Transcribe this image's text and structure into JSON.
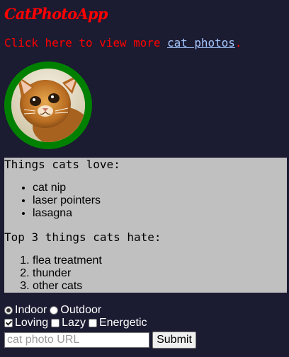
{
  "header": {
    "title": "CatPhotoApp"
  },
  "intro": {
    "prefix": "Click here to view more ",
    "link_text": "cat photos",
    "suffix": "."
  },
  "image": {
    "alt": "A cute orange cat lying on its back"
  },
  "lists": {
    "love_heading": "Things cats love:",
    "love_items": [
      "cat nip",
      "laser pointers",
      "lasagna"
    ],
    "hate_heading": "Top 3 things cats hate:",
    "hate_items": [
      "flea treatment",
      "thunder",
      "other cats"
    ]
  },
  "form": {
    "radios": [
      {
        "label": "Indoor",
        "checked": true
      },
      {
        "label": "Outdoor",
        "checked": false
      }
    ],
    "checkboxes": [
      {
        "label": "Loving",
        "checked": true
      },
      {
        "label": "Lazy",
        "checked": false
      },
      {
        "label": "Energetic",
        "checked": false
      }
    ],
    "url_input": {
      "placeholder": "cat photo URL",
      "value": ""
    },
    "submit_label": "Submit"
  },
  "colors": {
    "background": "#1b1b32",
    "title": "#ff0000",
    "link": "#a6c8ff",
    "ring": "#008000",
    "list_box": "#c0c0c0"
  }
}
